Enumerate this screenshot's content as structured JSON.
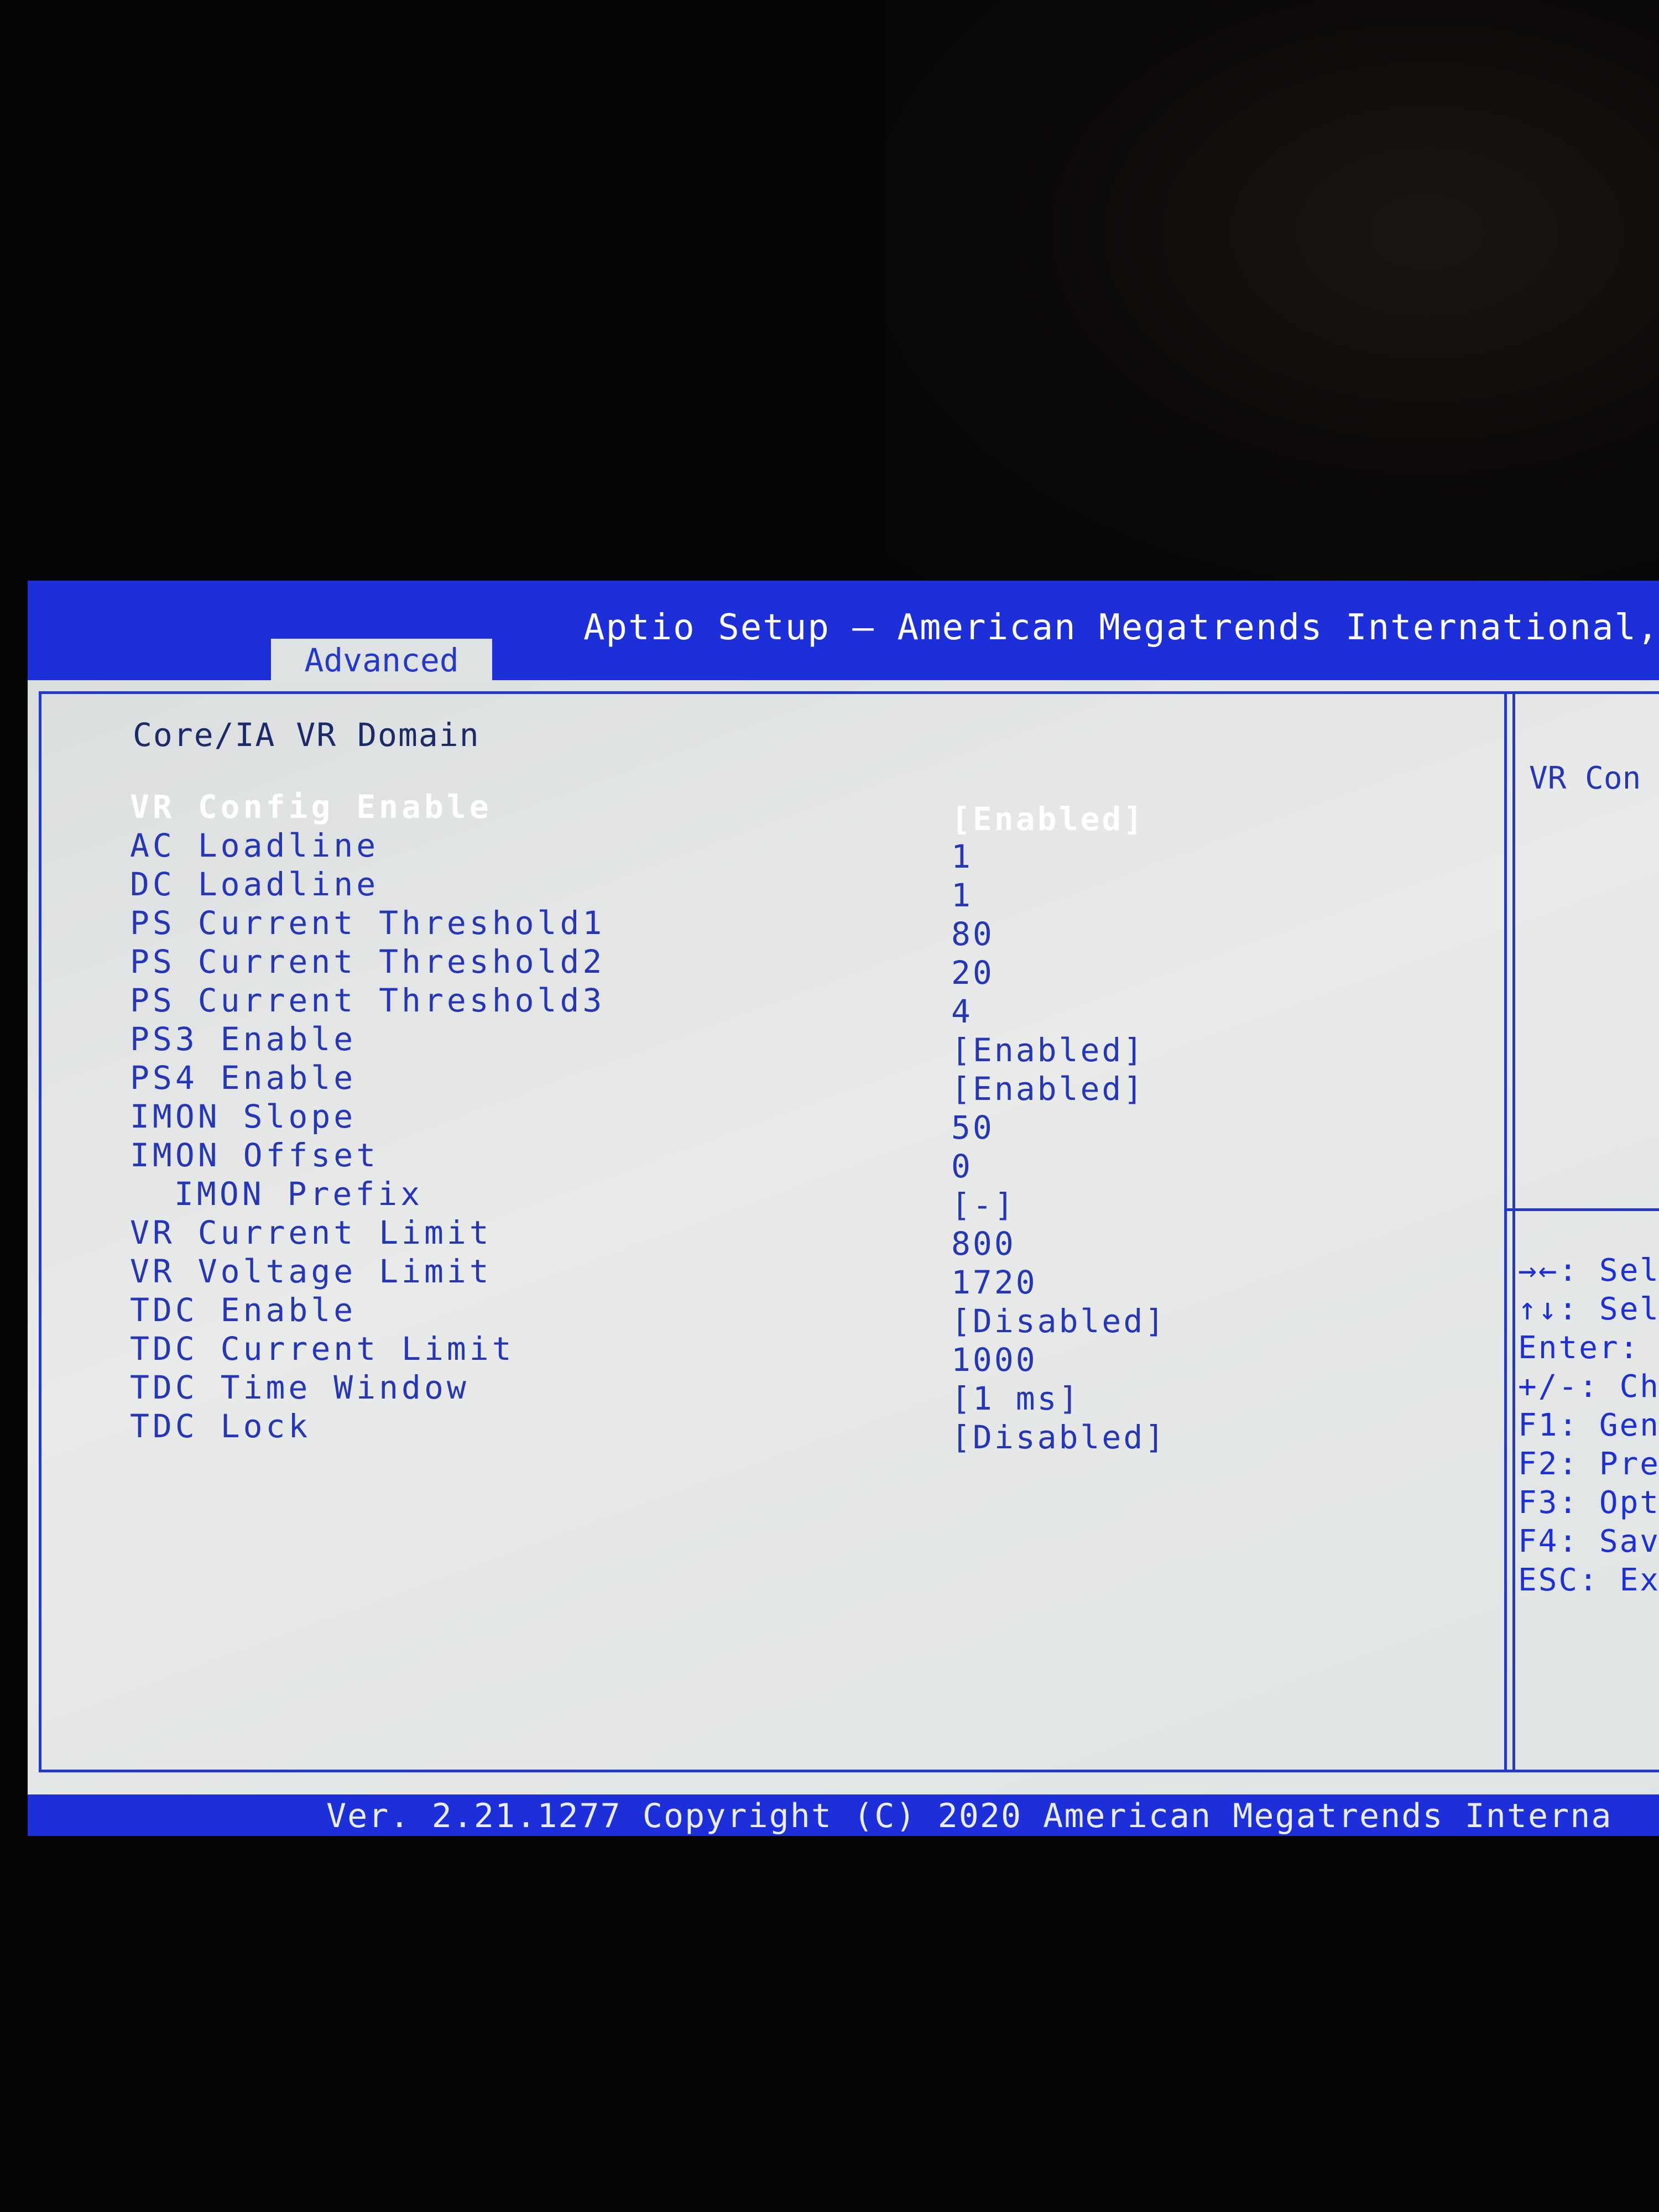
{
  "header": {
    "title": "Aptio Setup – American Megatrends International, LL",
    "tab": "Advanced"
  },
  "section_title": "Core/IA VR Domain",
  "settings": [
    {
      "label": "VR Config Enable",
      "value": "[Enabled]"
    },
    {
      "label": "AC Loadline",
      "value": "1"
    },
    {
      "label": "DC Loadline",
      "value": "1"
    },
    {
      "label": "PS Current Threshold1",
      "value": "80"
    },
    {
      "label": "PS Current Threshold2",
      "value": "20"
    },
    {
      "label": "PS Current Threshold3",
      "value": "4"
    },
    {
      "label": "PS3 Enable",
      "value": "[Enabled]"
    },
    {
      "label": "PS4 Enable",
      "value": "[Enabled]"
    },
    {
      "label": "IMON Slope",
      "value": "50"
    },
    {
      "label": "IMON Offset",
      "value": "0"
    },
    {
      "label": "IMON Prefix",
      "value": "[-]"
    },
    {
      "label": "VR Current Limit",
      "value": "800"
    },
    {
      "label": "VR Voltage Limit",
      "value": "1720"
    },
    {
      "label": "TDC Enable",
      "value": "[Disabled]"
    },
    {
      "label": "TDC Current Limit",
      "value": "1000"
    },
    {
      "label": "TDC Time Window",
      "value": "[1 ms]"
    },
    {
      "label": "TDC Lock",
      "value": "[Disabled]"
    }
  ],
  "help_panel": {
    "text": "VR Con",
    "keys": [
      "→←: Sel",
      "↑↓: Sel",
      "Enter:",
      "+/-: Ch",
      "F1: Gen",
      "F2: Pre",
      "F3: Opt",
      "F4: Sav",
      "ESC: Ex"
    ]
  },
  "footer": {
    "text": "Ver. 2.21.1277 Copyright (C) 2020 American Megatrends Interna"
  }
}
